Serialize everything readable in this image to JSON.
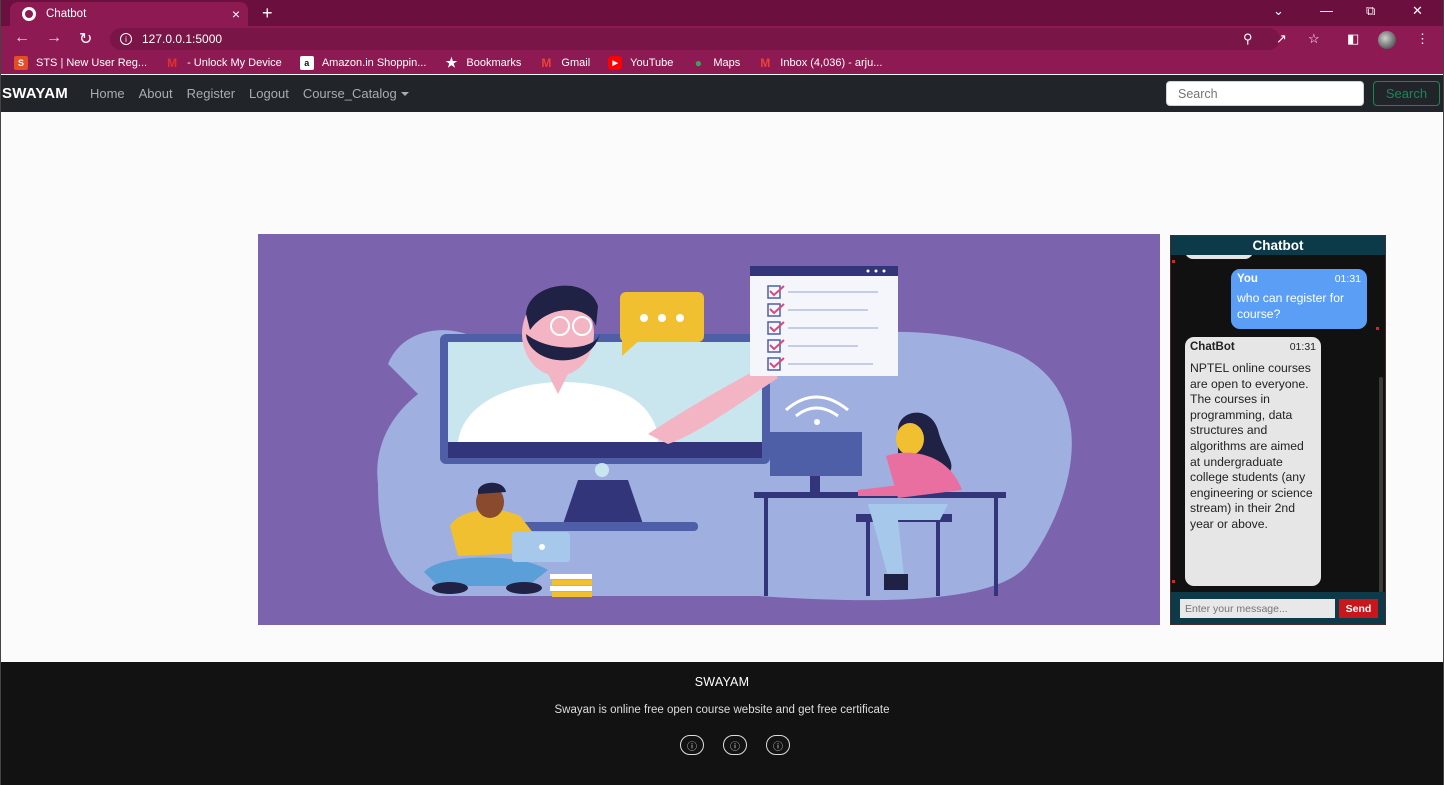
{
  "browser": {
    "tab_title": "Chatbot",
    "tab_close": "×",
    "new_tab": "+",
    "url": "127.0.0.1:5000",
    "bookmarks": [
      {
        "label": "STS | New User Reg...",
        "icon": "sts-icon",
        "color": "#e44d26"
      },
      {
        "label": "- Unlock My Device",
        "icon": "m-icon",
        "color": "#e0312c"
      },
      {
        "label": "Amazon.in Shoppin...",
        "icon": "amazon-icon",
        "color": "#ffffff"
      },
      {
        "label": "Bookmarks",
        "icon": "star-icon",
        "color": "#ffffff"
      },
      {
        "label": "Gmail",
        "icon": "gmail-icon",
        "color": "#ea4335"
      },
      {
        "label": "YouTube",
        "icon": "youtube-icon",
        "color": "#ff0000"
      },
      {
        "label": "Maps",
        "icon": "maps-icon",
        "color": "#34a853"
      },
      {
        "label": "Inbox (4,036) - arju...",
        "icon": "gmail-icon",
        "color": "#ea4335"
      }
    ]
  },
  "navbar": {
    "brand": "SWAYAM",
    "links": [
      "Home",
      "About",
      "Register",
      "Logout",
      "Course_Catalog"
    ],
    "search_placeholder": "Search",
    "search_button": "Search"
  },
  "chatbot": {
    "title": "Chatbot",
    "messages": [
      {
        "sender": "You",
        "time": "01:31",
        "text": "who can register for course?"
      },
      {
        "sender": "ChatBot",
        "time": "01:31",
        "text": "NPTEL online courses are open to everyone. The courses in programming, data structures and algorithms are aimed at undergraduate college students (any engineering or science stream) in their 2nd year or above."
      }
    ],
    "input_placeholder": "Enter your message...",
    "send_label": "Send"
  },
  "footer": {
    "title": "SWAYAM",
    "subtitle": "Swayan is online free open course website and get free certificate"
  },
  "colors": {
    "chrome": "#8e1a53",
    "navbar": "#212529",
    "hero_bg": "#7b64ad",
    "chat_header": "#0d3a49",
    "user_bubble": "#5a9ff5",
    "send_button": "#c8161d",
    "footer": "#121212"
  }
}
